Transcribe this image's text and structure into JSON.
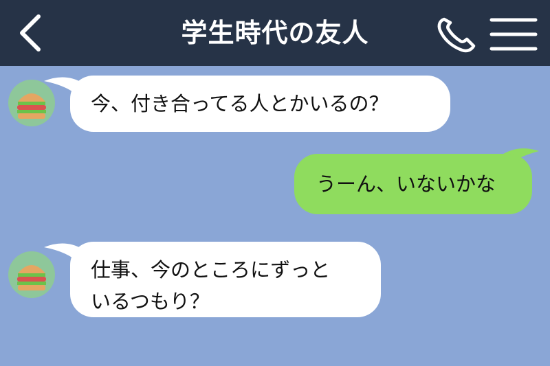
{
  "header": {
    "title": "学生時代の友人",
    "back_icon": "chevron-left-icon",
    "call_icon": "phone-icon",
    "menu_icon": "hamburger-menu-icon",
    "background": "#263347"
  },
  "chat": {
    "background": "#8aa6d6",
    "incoming_bubble_color": "#ffffff",
    "outgoing_bubble_color": "#8fdc5e",
    "messages": [
      {
        "side": "incoming",
        "avatar_icon": "hamburger-avatar-icon",
        "lines": [
          "今、付き合ってる人とかいるの？"
        ]
      },
      {
        "side": "outgoing",
        "lines": [
          "うーん、いないかな"
        ]
      },
      {
        "side": "incoming",
        "avatar_icon": "hamburger-avatar-icon",
        "lines": [
          "仕事、今のところにずっと",
          "いるつもり？"
        ]
      }
    ]
  }
}
